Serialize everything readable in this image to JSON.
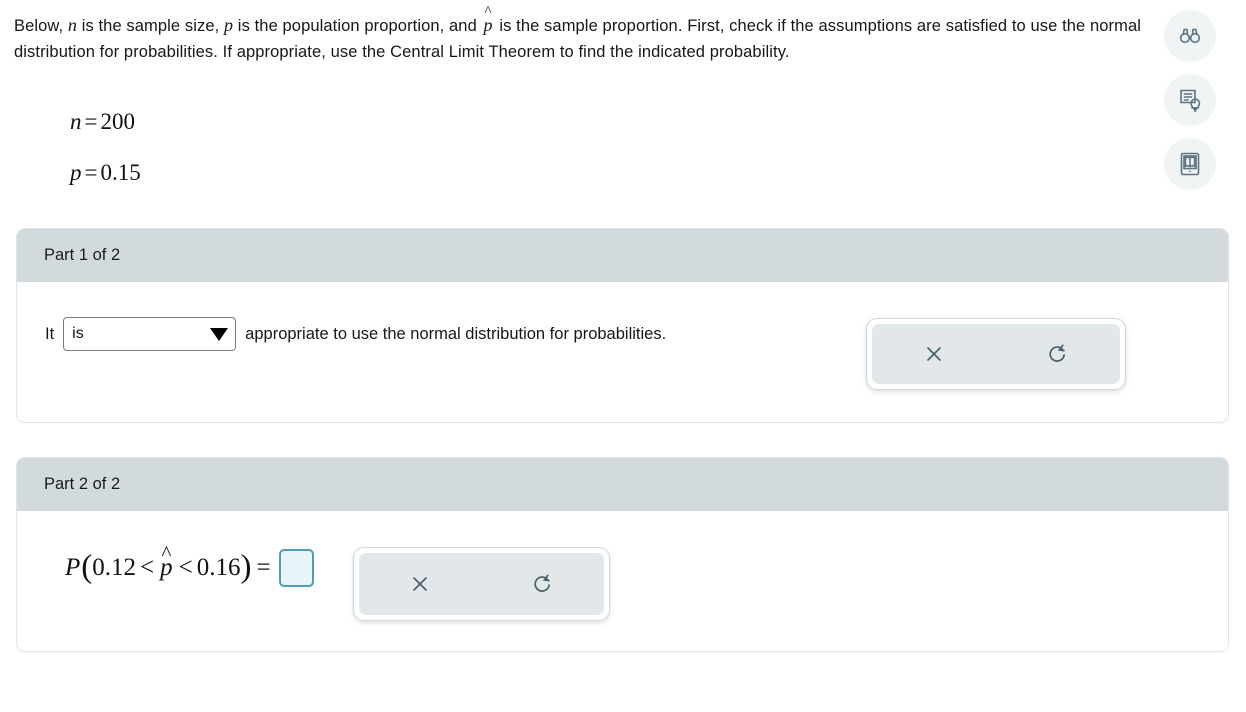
{
  "problem": {
    "intro_part1": "Below, ",
    "intro_n": "n",
    "intro_part2": " is the sample size, ",
    "intro_p": "p",
    "intro_part3": " is the population proportion, and ",
    "intro_phat": "p",
    "intro_part4": " is the sample proportion. First, check if the assumptions are satisfied to use the normal distribution for probabilities. If appropriate, use the Central Limit Theorem to find the indicated probability.",
    "givens": [
      {
        "var": "n",
        "eq": "=",
        "value": "200"
      },
      {
        "var": "p",
        "eq": "=",
        "value": "0.15"
      }
    ]
  },
  "tools": [
    {
      "name": "binoculars-icon",
      "label": "Binoculars"
    },
    {
      "name": "hint-document-icon",
      "label": "Hint"
    },
    {
      "name": "textbook-icon",
      "label": "Textbook"
    }
  ],
  "parts": [
    {
      "header": "Part 1 of 2",
      "lead_text": "It",
      "dropdown_value": "is",
      "dropdown_placeholder": "Select",
      "tail_text": "appropriate to use the normal distribution for probabilities.",
      "buttons": [
        {
          "name": "clear-button",
          "icon": "x-icon"
        },
        {
          "name": "undo-button",
          "icon": "undo-icon"
        }
      ]
    },
    {
      "header": "Part 2 of 2",
      "expression": {
        "fn": "P",
        "open_paren": "(",
        "lower": "0.12",
        "rel1": "<",
        "stat": "p",
        "rel2": "<",
        "upper": "0.16",
        "close_paren": ")",
        "equals": "=",
        "answer_value": ""
      },
      "buttons": [
        {
          "name": "clear-button",
          "icon": "x-icon"
        },
        {
          "name": "undo-button",
          "icon": "undo-icon"
        }
      ]
    }
  ],
  "colors": {
    "card_header_bg": "#d3dadd",
    "card_border": "#dfe4e8",
    "tool_bg": "#f1f4f5",
    "icon_stroke": "#5d7480",
    "answer_border": "#4e9cb5",
    "answer_fill": "#e9f4f9",
    "button_inner_bg": "#e2e7ea"
  }
}
